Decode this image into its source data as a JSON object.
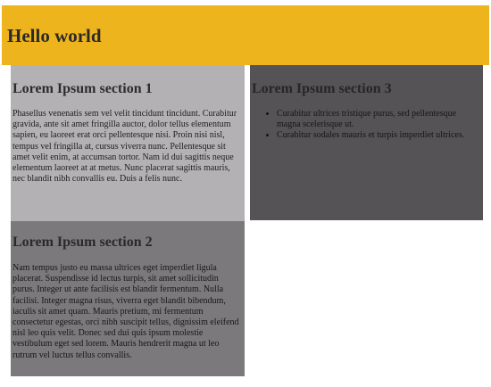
{
  "header": {
    "title": "Hello world"
  },
  "section1": {
    "heading": "Lorem Ipsum section 1",
    "body": "Phasellus venenatis sem vel velit tincidunt tincidunt. Curabitur gravida, ante sit amet fringilla auctor, dolor tellus elementum sapien, eu laoreet erat orci pellentesque nisi. Proin nisi nisl, tempus vel fringilla at, cursus viverra nunc. Pellentesque sit amet velit enim, at accumsan tortor. Nam id dui sagittis neque elementum laoreet at at metus. Nunc placerat sagittis mauris, nec blandit nibh convallis eu. Duis a felis nunc."
  },
  "section2": {
    "heading": "Lorem Ipsum section 2",
    "body": "Nam tempus justo eu massa ultrices eget imperdiet ligula placerat. Suspendisse id lectus turpis, sit amet sollicitudin purus. Integer ut ante facilisis est blandit fermentum. Nulla facilisi. Integer magna risus, viverra eget blandit bibendum, iaculis sit amet quam. Mauris pretium, mi fermentum consectetur egestas, orci nibh suscipit tellus, dignissim eleifend nisl leo quis velit. Donec sed dui quis ipsum molestie vestibulum eget sed lorem. Mauris hendrerit magna ut leo rutrum vel luctus tellus convallis."
  },
  "section3": {
    "heading": "Lorem Ipsum section 3",
    "items": [
      "Curabitur ultrices tristique purus, sed pellentesque magna scelerisque ut.",
      "Curabitur sodales mauris et turpis imperdiet ultrices."
    ]
  },
  "colors": {
    "header_bg": "#eeb41e",
    "section1_bg": "#b4b1b4",
    "section2_bg": "#7b797b",
    "section3_bg": "#555355"
  }
}
